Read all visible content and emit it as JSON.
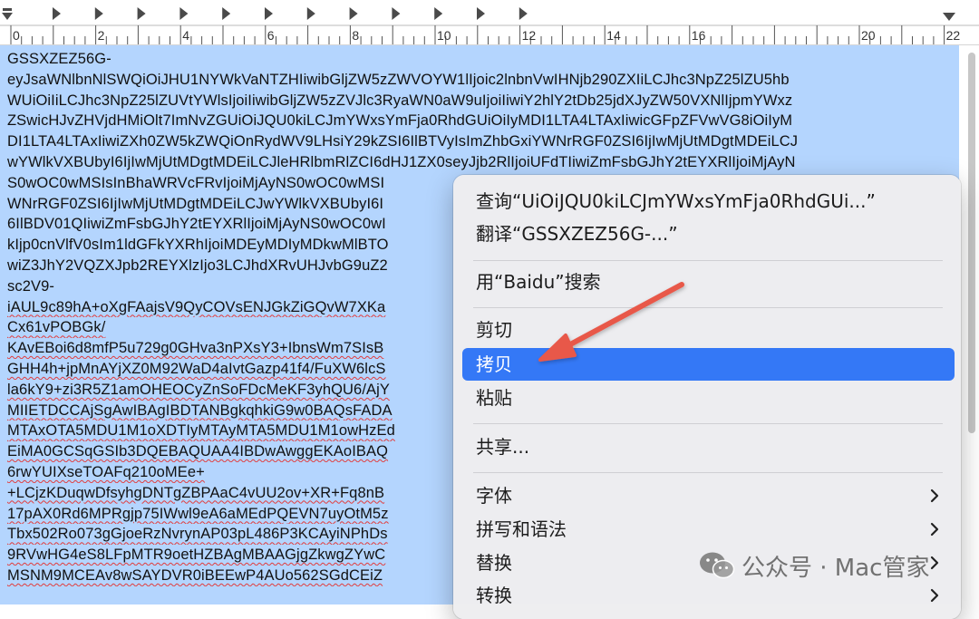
{
  "ruler": {
    "labels": [
      "0",
      "2",
      "4",
      "6",
      "8",
      "10",
      "12",
      "14",
      "16",
      "20",
      "22"
    ]
  },
  "document": {
    "lines": [
      "GSSXZEZ56G-",
      "eyJsaWNlbnNlSWQiOiJHU1NYWkVaNTZHIiwibGljZW5zZWVOYW1lIjoic2lnbnVwIHNjb290ZXIiLCJhc3NpZ25lZU5hb",
      "WUiOiIiLCJhc3NpZ25lZUVtYWlsIjoiIiwibGljZW5zZVJlc3RyaWN0aW9uIjoiIiwiY2hlY2tDb25jdXJyZW50VXNlIjpmYWxz",
      "ZSwicHJvZHVjdHMiOlt7ImNvZGUiOiJQU0kiLCJmYWxsYmFja0RhdGUiOiIyMDI1LTA4LTAxIiwicGFpZFVwVG8iOiIyM",
      "DI1LTA4LTAxIiwiZXh0ZW5kZWQiOnRydWV9LHsiY29kZSI6IlBTVyIsImZhbGxiYWNrRGF0ZSI6IjIwMjUtMDgtMDEiLCJ",
      "wYWlkVXBUbyI6IjIwMjUtMDgtMDEiLCJleHRlbmRlZCI6dHJ1ZX0seyJjb2RlIjoiUFdTIiwiZmFsbGJhY2tEYXRlIjoiMjAyN",
      "S0wOC0wMSIsInBhaWRVcFRvIjoiMjAyNS0wOC0wMSI",
      "WNrRGF0ZSI6IjIwMjUtMDgtMDEiLCJwYWlkVXBUbyI6I",
      "6IlBDV01QIiwiZmFsbGJhY2tEYXRlIjoiMjAyNS0wOC0wI",
      "kIjp0cnVlfV0sIm1ldGFkYXRhIjoiMDEyMDIyMDkwMlBTO",
      "wiZ3JhY2VQZXJpb2REYXlzIjo3LCJhdXRvUHJvbG9uZ2",
      "sc2V9-",
      "iAUL9c89hA+oXgFAajsV9QyCOVsENJGkZiGQvW7XKa",
      "Cx61vPOBGk/",
      "KAvEBoi6d8mfP5u729g0GHva3nPXsY3+IbnsWm7SIsB",
      "GHH4h+jpMnAYjXZ0M92WaD4aIvtGazp41f4/FuXW6lcS",
      "la6kY9+zi3R5Z1amOHEOCyZnSoFDcMeKF3yhQU6/AjY",
      "MIIETDCCAjSgAwIBAgIBDTANBgkqhkiG9w0BAQsFADA",
      "MTAxOTA5MDU1M1oXDTIyMTAyMTA5MDU1M1owHzEd",
      "EiMA0GCSqGSIb3DQEBAQUAA4IBDwAwggEKAoIBAQ",
      "6rwYUIXseTOAFq210oMEe+",
      "+LCjzKDuqwDfsyhgDNTgZBPAaC4vUU2ov+XR+Fq8nB",
      "17pAX0Rd6MPRgjp75IWwl9eA6aMEdPQEVN7uyOtM5z",
      "Tbx502Ro073gGjoeRzNvrynAP03pL486P3KCAyiNPhDs",
      "9RVwHG4eS8LFpMTR9oetHZBAgMBAAGjgZkwgZYwC",
      "MSNM9MCEAv8wSAYDVR0iBEEwP4AUo562SGdCEiZ"
    ]
  },
  "menu": {
    "items": [
      {
        "id": "lookup",
        "label": "查询“UiOiJQU0kiLCJmYWxsYmFja0RhdGUi...”",
        "submenu": false,
        "active": false
      },
      {
        "id": "translate",
        "label": "翻译“GSSXZEZ56G-...”",
        "submenu": false,
        "active": false
      },
      {
        "id": "search-baidu",
        "label": "用“Baidu”搜索",
        "submenu": false,
        "active": false
      },
      {
        "id": "cut",
        "label": "剪切",
        "submenu": false,
        "active": false
      },
      {
        "id": "copy",
        "label": "拷贝",
        "submenu": false,
        "active": true
      },
      {
        "id": "paste",
        "label": "粘贴",
        "submenu": false,
        "active": false
      },
      {
        "id": "share",
        "label": "共享...",
        "submenu": false,
        "active": false
      },
      {
        "id": "font",
        "label": "字体",
        "submenu": true,
        "active": false
      },
      {
        "id": "spelling",
        "label": "拼写和语法",
        "submenu": true,
        "active": false
      },
      {
        "id": "substitutions",
        "label": "替换",
        "submenu": true,
        "active": false
      },
      {
        "id": "transformations",
        "label": "转换",
        "submenu": true,
        "active": false
      }
    ]
  },
  "watermark": {
    "text": "公众号 · Mac管家",
    "icon": "wechat-icon"
  },
  "colors": {
    "selection": "#b4d5fe",
    "menu_highlight": "#3478f6",
    "arrow": "#e8584a"
  }
}
